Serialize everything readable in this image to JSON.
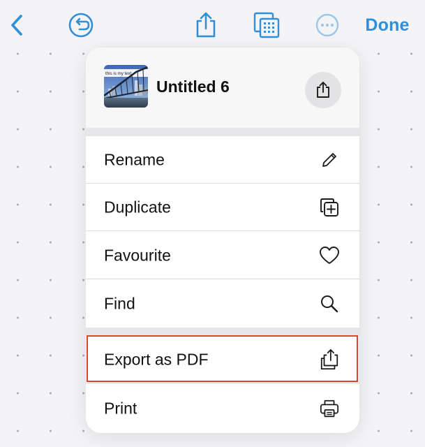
{
  "toolbar": {
    "back_icon": "chevron-left-icon",
    "undo_icon": "undo-circle-icon",
    "share_icon": "share-icon",
    "gallery_icon": "gallery-grid-icon",
    "more_icon": "more-circle-icon",
    "done_label": "Done",
    "accent_color": "#2f8fd8"
  },
  "menu": {
    "header": {
      "thumbnail_caption": "this is my text",
      "title": "Untitled 6",
      "share_icon": "share-icon"
    },
    "items": [
      {
        "label": "Rename",
        "icon": "pencil-icon"
      },
      {
        "label": "Duplicate",
        "icon": "duplicate-icon"
      },
      {
        "label": "Favourite",
        "icon": "heart-icon"
      },
      {
        "label": "Find",
        "icon": "magnifier-icon"
      },
      {
        "label": "Export as PDF",
        "icon": "export-icon",
        "highlighted": true
      },
      {
        "label": "Print",
        "icon": "printer-icon"
      }
    ]
  },
  "highlight_color": "#e0422b"
}
